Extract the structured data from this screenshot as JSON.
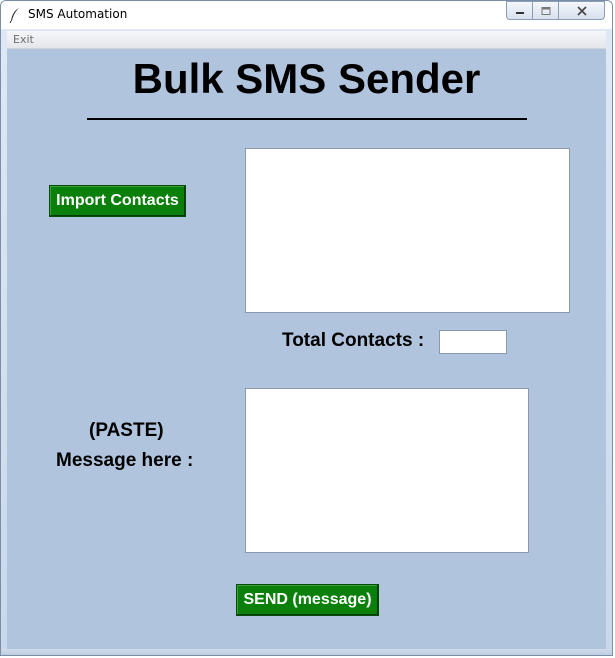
{
  "window": {
    "title": "SMS Automation",
    "icon": "feather-icon"
  },
  "menu": {
    "exit_label": "Exit"
  },
  "app": {
    "heading": "Bulk SMS Sender",
    "import_button": "Import Contacts",
    "contacts_text": "",
    "total_label": "Total Contacts :",
    "total_value": "",
    "paste_label": "(PASTE)",
    "message_label": "Message here :",
    "message_text": "",
    "send_button": "SEND (message)"
  },
  "colors": {
    "background": "#b0c4de",
    "button": "#0a800a",
    "button_text": "#ffffff"
  }
}
